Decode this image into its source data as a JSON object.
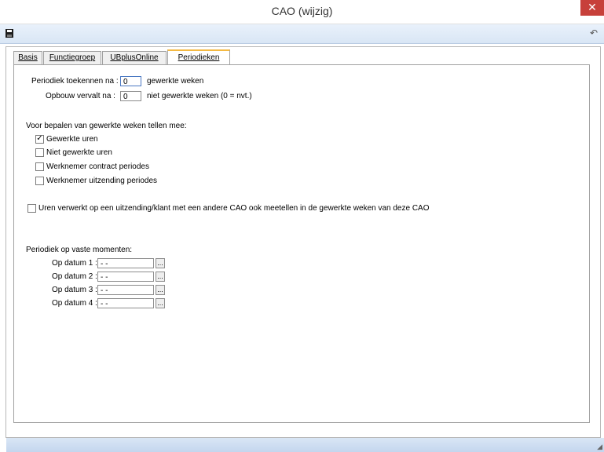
{
  "window": {
    "title": "CAO  (wijzig)",
    "close_glyph": "✕"
  },
  "toolbar": {
    "save_icon": "save-icon",
    "undo_icon": "undo-icon",
    "undo_glyph": "↶"
  },
  "tabs": [
    {
      "label": "Basis",
      "active": false
    },
    {
      "label": "Functiegroep",
      "active": false
    },
    {
      "label": "UBplusOnline",
      "active": false
    },
    {
      "label": "Periodieken",
      "active": true
    }
  ],
  "form": {
    "periodiek_label": "Periodiek toekennen na :",
    "periodiek_value": "0",
    "periodiek_suffix": "gewerkte weken",
    "opbouw_label": "Opbouw vervalt na :",
    "opbouw_value": "0",
    "opbouw_suffix": "niet gewerkte weken (0 = nvt.)",
    "section_title": "Voor bepalen van gewerkte weken tellen mee:",
    "checkboxes": [
      {
        "label": "Gewerkte uren",
        "checked": true
      },
      {
        "label": "Niet gewerkte uren",
        "checked": false
      },
      {
        "label": "Werknemer contract periodes",
        "checked": false
      },
      {
        "label": "Werknemer uitzending periodes",
        "checked": false
      }
    ],
    "uren_checkbox": {
      "label": "Uren verwerkt op een uitzending/klant met een andere CAO ook meetellen in de gewerkte weken van deze CAO",
      "checked": false
    },
    "vaste_title": "Periodiek op vaste momenten:",
    "dates": [
      {
        "label": "Op datum 1 :",
        "value": "  -  -"
      },
      {
        "label": "Op datum 2 :",
        "value": "  -  -"
      },
      {
        "label": "Op datum 3 :",
        "value": "  -  -"
      },
      {
        "label": "Op datum 4 :",
        "value": "  -  -"
      }
    ],
    "picker_label": "..."
  },
  "colors": {
    "active_tab_accent": "#f4b942",
    "close_button": "#c7403a",
    "toolbar": "#dfe9f6"
  }
}
